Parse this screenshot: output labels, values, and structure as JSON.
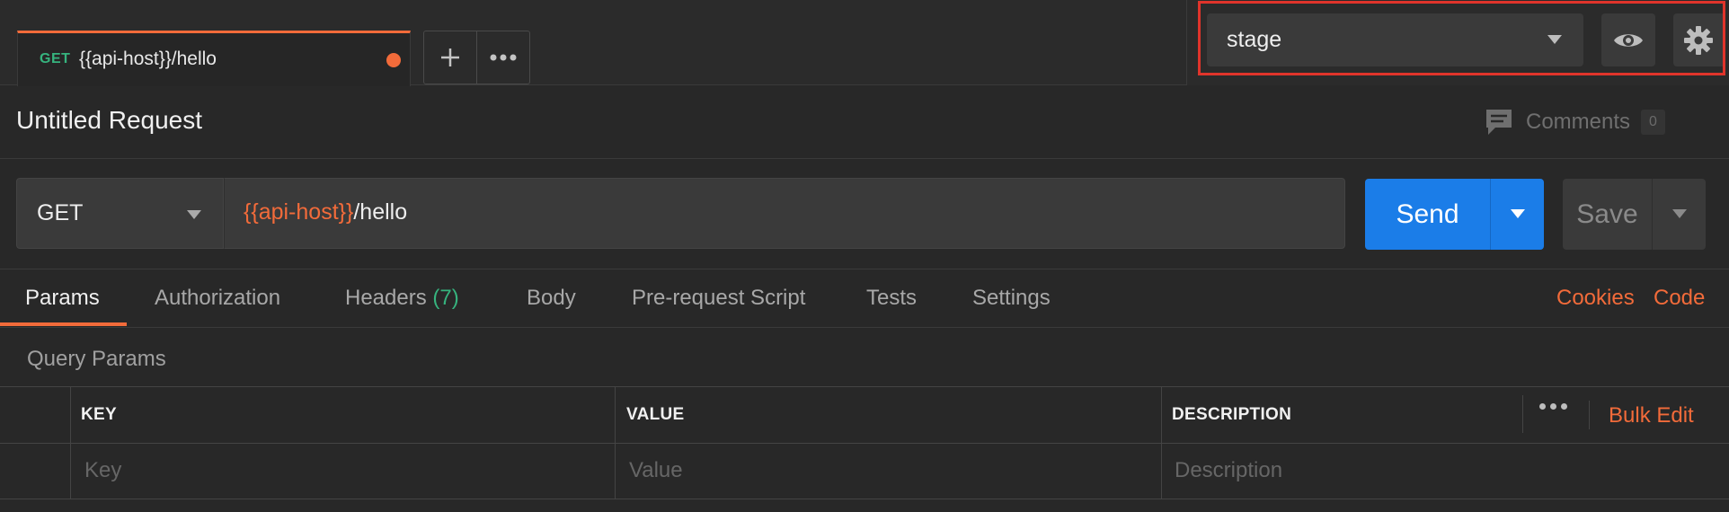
{
  "request_tab": {
    "method": "GET",
    "title": "{{api-host}}/hello",
    "unsaved_color": "#f26b3a"
  },
  "tab_actions": {
    "new_tab_icon": "plus-icon",
    "more_icon": "more-horizontal-icon"
  },
  "environment": {
    "selected": "stage",
    "quick_look_icon": "eye-icon",
    "manage_icon": "gear-icon",
    "highlight_color": "#e0342b"
  },
  "request": {
    "name": "Untitled Request",
    "comments_label": "Comments",
    "comments_count": "0"
  },
  "url_bar": {
    "method": "GET",
    "url_variable": "{{api-host}}",
    "url_path": "/hello",
    "send_label": "Send",
    "save_label": "Save",
    "accent_color": "#1b7de8"
  },
  "tabs": [
    {
      "label": "Params",
      "active": true
    },
    {
      "label": "Authorization"
    },
    {
      "label": "Headers",
      "count": "(7)"
    },
    {
      "label": "Body"
    },
    {
      "label": "Pre-request Script"
    },
    {
      "label": "Tests"
    },
    {
      "label": "Settings"
    }
  ],
  "links": {
    "cookies": "Cookies",
    "code": "Code"
  },
  "params": {
    "section_title": "Query Params",
    "columns": [
      "KEY",
      "VALUE",
      "DESCRIPTION"
    ],
    "bulk_edit": "Bulk Edit",
    "placeholders": [
      "Key",
      "Value",
      "Description"
    ]
  }
}
